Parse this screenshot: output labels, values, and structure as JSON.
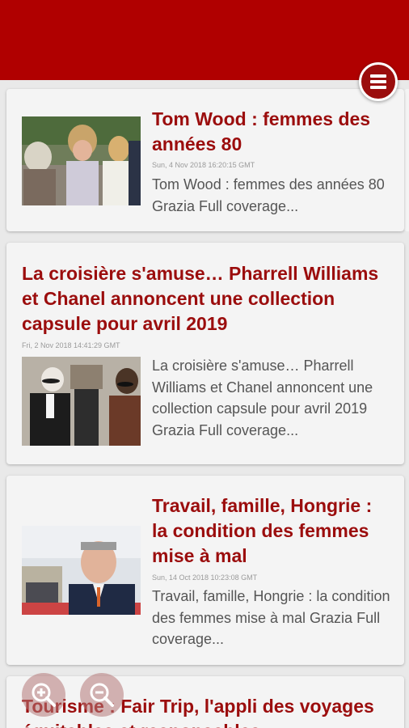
{
  "menu_icon": "hamburger-menu-icon",
  "articles": [
    {
      "title": "Tom Wood : femmes des années 80",
      "date": "Sun, 4 Nov 2018 16:20:15 GMT",
      "description": "Tom Wood : femmes des années 80  Grazia  Full coverage..."
    },
    {
      "title": "La croisière s'amuse… Pharrell Williams et Chanel annoncent une collection capsule pour avril 2019",
      "date": "Fri, 2 Nov 2018 14:41:29 GMT",
      "description": "La croisière s'amuse… Pharrell Williams et Chanel annoncent une collection capsule pour avril 2019  Grazia  Full coverage..."
    },
    {
      "title": "Travail, famille, Hongrie : la condition des femmes mise à mal",
      "date": "Sun, 14 Oct 2018 10:23:08 GMT",
      "description": "Travail, famille, Hongrie : la condition des femmes mise à mal  Grazia  Full coverage..."
    },
    {
      "title": "Tourisme : Fair Trip, l'appli des voyages équitables et responsables"
    }
  ],
  "zoom": {
    "in_icon": "zoom-in-icon",
    "out_icon": "zoom-out-icon"
  },
  "colors": {
    "accent": "#b00000",
    "title": "#9b0d0d"
  }
}
